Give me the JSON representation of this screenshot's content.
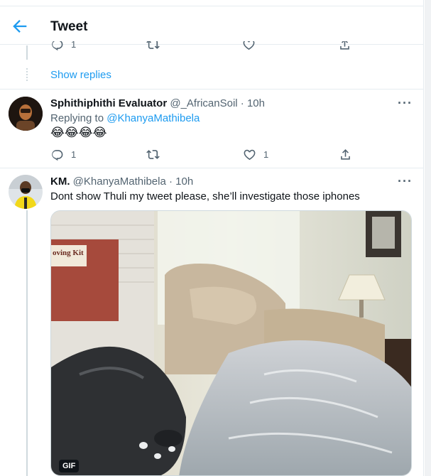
{
  "header": {
    "title": "Tweet"
  },
  "prev_tweet": {
    "reply_count": "1"
  },
  "show_replies": "Show replies",
  "tweet1": {
    "name": "Sphithiphithi Evaluator",
    "handle": "@_AfricanSoil",
    "time": "· 10h",
    "replying_prefix": "Replying to",
    "replying_to": "@KhanyaMathibela",
    "text": "😂😂😂😂",
    "reply_count": "1",
    "like_count": "1"
  },
  "tweet2": {
    "name": "KM.",
    "handle": "@KhanyaMathibela",
    "time": "· 10h",
    "text": "Dont show Thuli my tweet please, she’ll investigate those iphones",
    "gif_badge": "GIF",
    "box_label": "oving Kit"
  },
  "colors": {
    "accent": "#1d9bf0",
    "secondary": "#536471",
    "border": "#e6ecf0"
  },
  "icons": [
    "back-arrow-icon",
    "reply-icon",
    "retweet-icon",
    "like-icon",
    "share-icon",
    "more-icon"
  ]
}
